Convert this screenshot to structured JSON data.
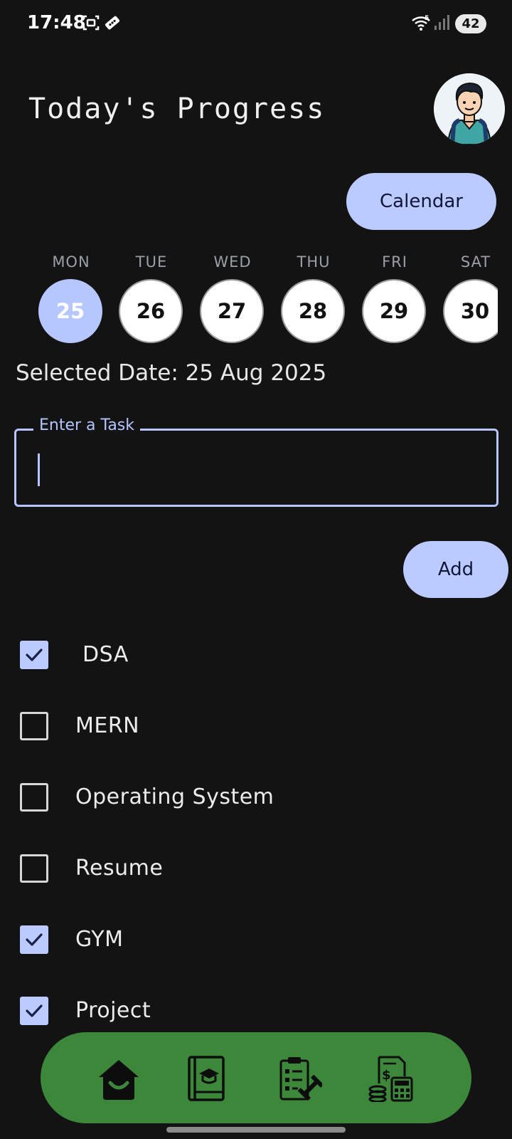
{
  "status_bar": {
    "time": "17:48",
    "battery": "42",
    "icons": [
      "screenshot-icon",
      "ticket-icon",
      "wifi-icon",
      "signal-icon"
    ]
  },
  "header": {
    "title": "Today's Progress",
    "avatar": "avatar"
  },
  "calendar_button": "Calendar",
  "week": [
    {
      "day": "MON",
      "date": "25",
      "selected": true
    },
    {
      "day": "TUE",
      "date": "26",
      "selected": false
    },
    {
      "day": "WED",
      "date": "27",
      "selected": false
    },
    {
      "day": "THU",
      "date": "28",
      "selected": false
    },
    {
      "day": "FRI",
      "date": "29",
      "selected": false
    },
    {
      "day": "SAT",
      "date": "30",
      "selected": false
    }
  ],
  "selected_date": "Selected Date: 25 Aug 2025",
  "task_input": {
    "label": "Enter a Task",
    "value": "",
    "placeholder": ""
  },
  "add_button": "Add",
  "tasks": [
    {
      "label": "DSA",
      "checked": true
    },
    {
      "label": "MERN",
      "checked": false
    },
    {
      "label": "Operating System",
      "checked": false
    },
    {
      "label": "Resume",
      "checked": false
    },
    {
      "label": "GYM",
      "checked": true
    },
    {
      "label": "Project",
      "checked": true
    }
  ],
  "bottom_nav": {
    "items": [
      {
        "icon": "home-icon"
      },
      {
        "icon": "study-book-icon"
      },
      {
        "icon": "workout-plan-icon"
      },
      {
        "icon": "finance-calculator-icon"
      }
    ]
  },
  "colors": {
    "background": "#131313",
    "accent": "#bccbff",
    "nav": "#3c873a"
  }
}
